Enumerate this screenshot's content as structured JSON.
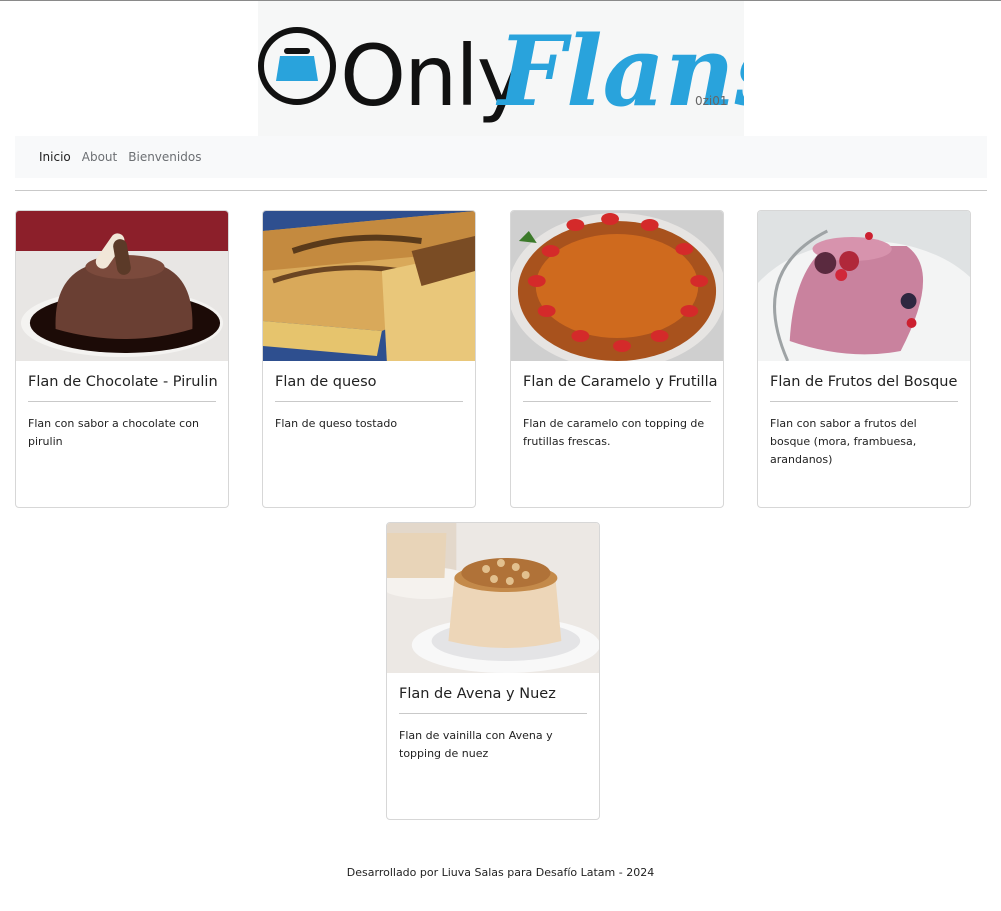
{
  "brand": {
    "logo_word_1": "Only",
    "logo_word_2": "Flans",
    "logo_suffix": "0zi01",
    "colors": {
      "black": "#111111",
      "blue": "#29a3dc"
    }
  },
  "nav": {
    "items": [
      {
        "label": "Inicio"
      },
      {
        "label": "About"
      },
      {
        "label": "Bienvenidos"
      }
    ]
  },
  "cards": [
    {
      "title": "Flan de Chocolate - Pirulin",
      "description": "Flan con sabor a chocolate con pirulin",
      "image": "chocolate-flan"
    },
    {
      "title": "Flan de queso",
      "description": "Flan de queso tostado",
      "image": "cheese-tart"
    },
    {
      "title": "Flan de Caramelo y Frutilla",
      "description": "Flan de caramelo con topping de frutillas frescas.",
      "image": "caramel-strawberry-flan"
    },
    {
      "title": "Flan de Frutos del Bosque",
      "description": "Flan con sabor a frutos del bosque (mora, frambuesa, arandanos)",
      "image": "berry-flan"
    },
    {
      "title": "Flan de Avena y Nuez",
      "description": "Flan de vainilla con Avena y topping de nuez",
      "image": "oat-walnut-flan"
    }
  ],
  "footer": {
    "text": "Desarrollado por Liuva Salas para Desafío Latam - 2024"
  }
}
